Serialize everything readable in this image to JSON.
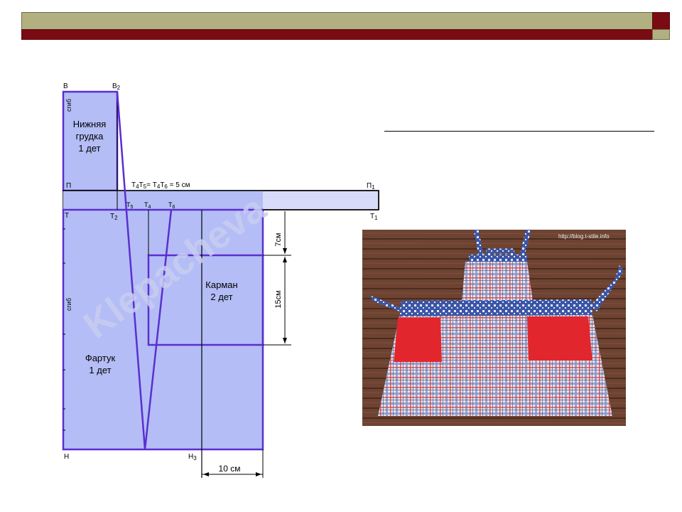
{
  "pattern": {
    "watermark": "Klepacheva",
    "points": {
      "V": "В",
      "V2": "В",
      "V2_sub": "2",
      "P": "П",
      "P1": "П",
      "P1_sub": "1",
      "T": "Т",
      "T1": "Т",
      "T1_sub": "1",
      "T2": "Т",
      "T2_sub": "2",
      "T4": "Т",
      "T4_sub": "4",
      "T5": "Т",
      "T5_sub": "5",
      "T6": "Т",
      "T6_sub": "6",
      "N": "Н",
      "N3": "Н",
      "N3_sub": "3"
    },
    "formula": {
      "a": "Т",
      "a_sub": "4",
      "b": "Т",
      "b_sub": "5",
      "eq1": "= Т",
      "c_sub": "4",
      "d": "Т",
      "d_sub": "6",
      "tail": " = 5 см"
    },
    "fold_label": "сгиб",
    "pieces": {
      "bib": [
        "Нижняя",
        "грудка",
        "1 дет"
      ],
      "apron": [
        "Фартук",
        "1 дет"
      ],
      "pocket": [
        "Карман",
        "2 дет"
      ]
    },
    "dims": {
      "top_gap": "7см",
      "pocket_h": "15см",
      "bottom_w": "10 см"
    }
  },
  "photo": {
    "url_text": "http://blog.t-stile.info"
  },
  "colors": {
    "title_bar": "#b2b080",
    "accent": "#7b0b12",
    "pattern_fill": "#b4bdf5",
    "pattern_line": "#5a2fd0",
    "table_wood": "#6e4332",
    "pocket_red": "#e2262e"
  }
}
